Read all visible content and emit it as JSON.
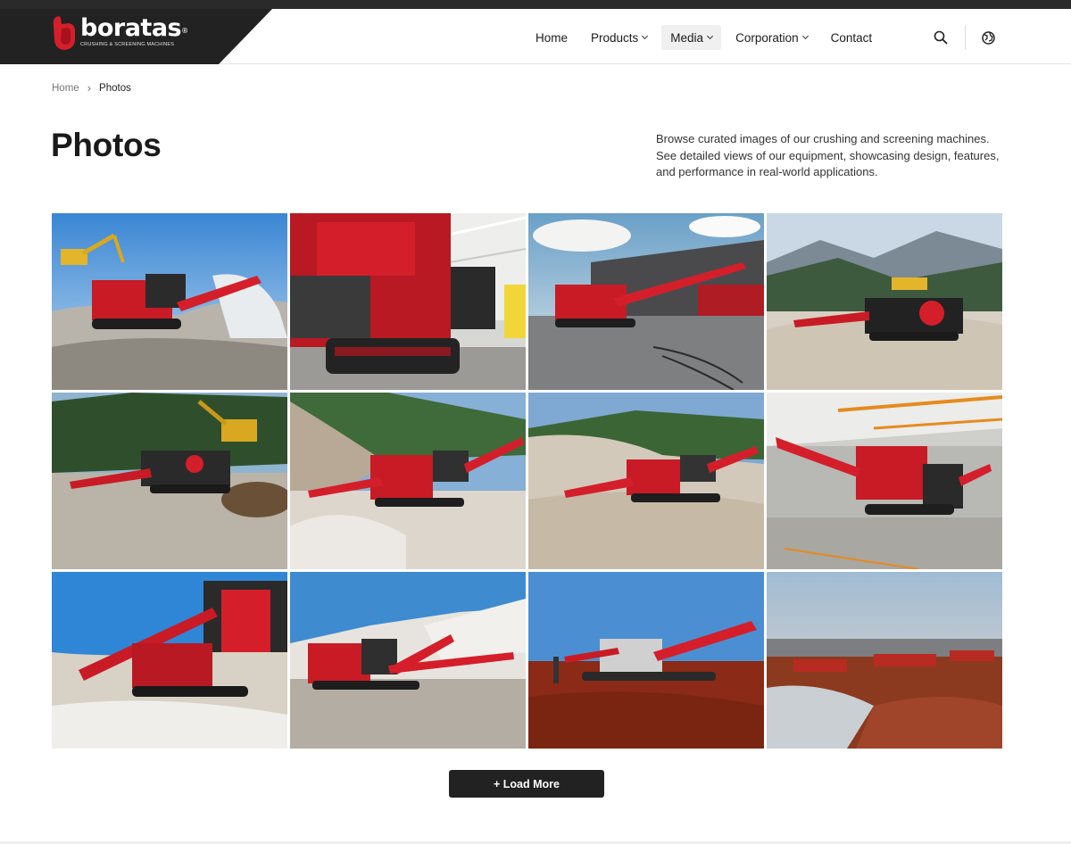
{
  "brand": {
    "name": "boratas",
    "trademark": "®",
    "tagline": "Crushing & Screening Machines",
    "accent_color": "#d41f2b",
    "dark_color": "#222222"
  },
  "nav": {
    "items": [
      {
        "label": "Home",
        "has_dropdown": false,
        "active": false
      },
      {
        "label": "Products",
        "has_dropdown": true,
        "active": false
      },
      {
        "label": "Media",
        "has_dropdown": true,
        "active": true
      },
      {
        "label": "Corporation",
        "has_dropdown": true,
        "active": false
      },
      {
        "label": "Contact",
        "has_dropdown": false,
        "active": false
      }
    ],
    "icons": [
      "search-icon",
      "globe-icon"
    ]
  },
  "breadcrumb": {
    "home": "Home",
    "separator": "›",
    "current": "Photos"
  },
  "page": {
    "title": "Photos",
    "intro": "Browse curated images of our crushing and screening machines. See detailed views of our equipment, showcasing design, features, and performance in real-world applications."
  },
  "gallery": {
    "photo_count": 12,
    "photos": [
      {
        "scene": "quarry-sky-excavator"
      },
      {
        "scene": "factory-closeup"
      },
      {
        "scene": "showroom-building"
      },
      {
        "scene": "mountain-valley"
      },
      {
        "scene": "forest-quarry-excavator"
      },
      {
        "scene": "white-quarry"
      },
      {
        "scene": "white-quarry-hills"
      },
      {
        "scene": "factory-hall"
      },
      {
        "scene": "bright-quarry"
      },
      {
        "scene": "white-quarry-blue-sky"
      },
      {
        "scene": "red-earth-site"
      },
      {
        "scene": "red-earth-wide"
      }
    ]
  },
  "load_more": {
    "label": "+ Load More"
  }
}
